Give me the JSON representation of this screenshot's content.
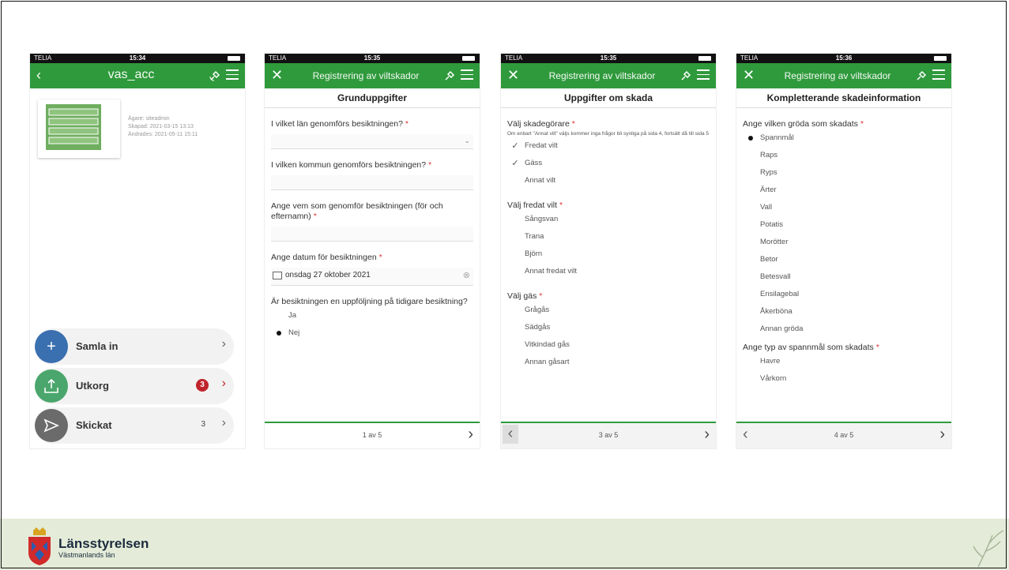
{
  "phones": [
    {
      "carrier": "TELIA",
      "time": "15:34",
      "left_icon": "back-chevron-icon",
      "title": "vas_acc",
      "meta": [
        "Ägare: siteadmin",
        "Skapad: 2021-03-15 13:13",
        "Ändrades: 2021-05-11 15:11"
      ],
      "items": [
        {
          "label": "Samla in",
          "icon": "plus-icon",
          "color": "#3a6fb0"
        },
        {
          "label": "Utkorg",
          "icon": "outbox-icon",
          "color": "#4aa66c",
          "badge": "3"
        },
        {
          "label": "Skickat",
          "icon": "send-icon",
          "color": "#6b6b6b",
          "count": "3"
        }
      ]
    },
    {
      "carrier": "TELIA",
      "time": "15:35",
      "title": "Registrering av viltskador",
      "heading": "Grunduppgifter",
      "q1": "I vilket län genomförs besiktningen?",
      "q2": "I vilken kommun genomförs besiktningen?",
      "q3": "Ange vem som genomför besiktningen (för och efternamn)",
      "q4": "Ange datum för besiktningen",
      "date_value": "onsdag 27 oktober 2021",
      "q5": "Är besiktningen en uppföljning på tidigare besiktning?",
      "opt_ja": "Ja",
      "opt_nej": "Nej",
      "page": "1 av 5"
    },
    {
      "carrier": "TELIA",
      "time": "15:35",
      "title": "Registrering av viltskador",
      "heading": "Uppgifter om skada",
      "q1": "Välj skadegörare",
      "note": "Om enbart \"Annat vilt\" väljs kommer inga frågor bli synliga på sida 4, fortsätt då till sida 5",
      "damage": [
        "Fredat vilt",
        "Gäss",
        "Annat vilt"
      ],
      "q2": "Välj fredat vilt",
      "protected": [
        "Sångsvan",
        "Trana",
        "Björn",
        "Annat fredat vilt"
      ],
      "q3": "Välj gäs",
      "geese": [
        "Grågås",
        "Sädgås",
        "Vitkindad gås",
        "Annan gåsart"
      ],
      "page": "3 av 5"
    },
    {
      "carrier": "TELIA",
      "time": "15:36",
      "title": "Registrering av viltskador",
      "heading": "Kompletterande skadeinformation",
      "q1": "Ange vilken gröda som skadats",
      "crops": [
        "Spannmål",
        "Raps",
        "Ryps",
        "Ärter",
        "Vall",
        "Potatis",
        "Morötter",
        "Betor",
        "Betesvall",
        "Ensilagebal",
        "Åkerböna",
        "Annan gröda"
      ],
      "q2": "Ange typ av spannmål som skadats",
      "grain": [
        "Havre",
        "Vårkorn"
      ],
      "page": "4 av 5"
    }
  ],
  "required_mark": "*",
  "footer": {
    "name": "Länsstyrelsen",
    "sub": "Västmanlands län"
  },
  "colors": {
    "app_green": "#2f9a3c",
    "footer_bg": "#e4ecd9",
    "badge_red": "#c0242c"
  }
}
